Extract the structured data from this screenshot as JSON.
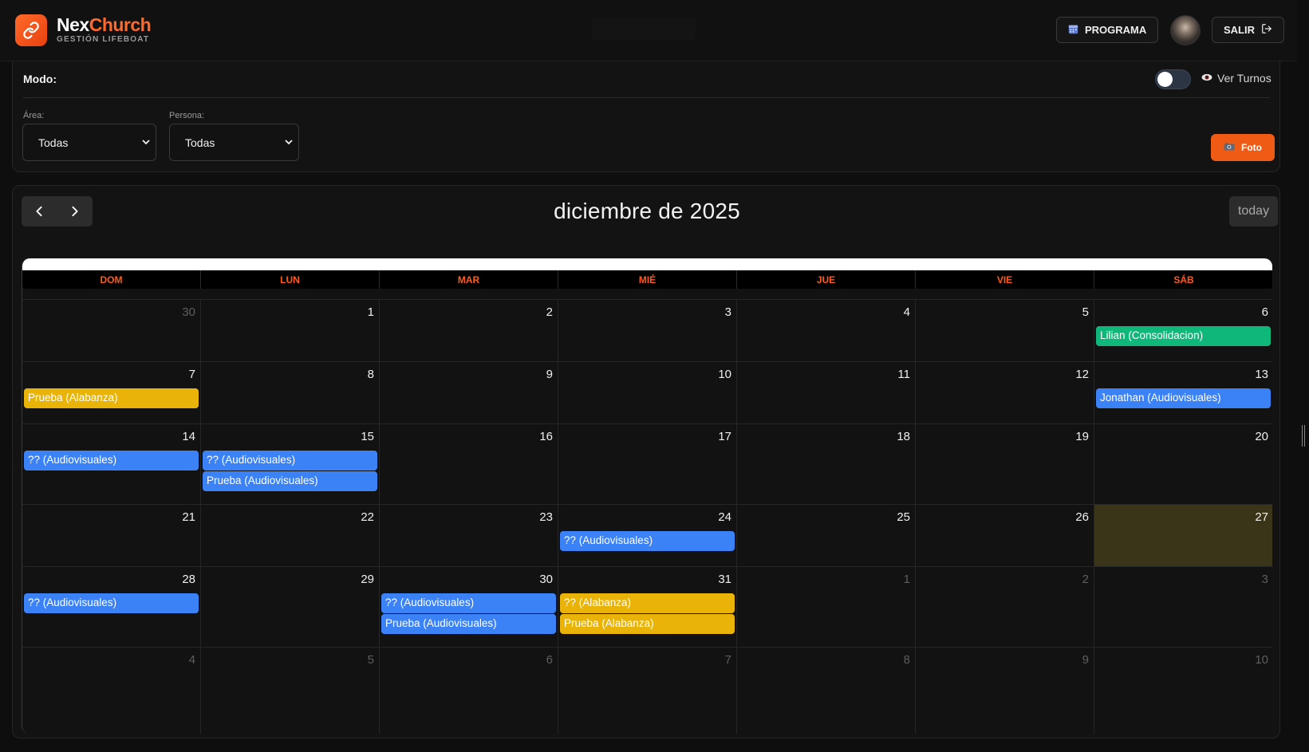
{
  "header": {
    "brand_first": "Nex",
    "brand_second": "Church",
    "subtitle": "GESTIÓN LIFEBOAT",
    "programa_label": "PROGRAMA",
    "salir_label": "SALIR"
  },
  "filters": {
    "mode_label": "Modo:",
    "ver_turnos_label": "Ver Turnos",
    "area_label": "Área:",
    "area_value": "Todas",
    "persona_label": "Persona:",
    "persona_value": "Todas",
    "foto_label": "Foto"
  },
  "calendar": {
    "title": "diciembre de 2025",
    "today_label": "today",
    "weekdays": [
      "DOM",
      "LUN",
      "MAR",
      "MIÉ",
      "JUE",
      "VIE",
      "SÁB"
    ],
    "weeks": [
      [
        {
          "num": "30",
          "other": true,
          "events": []
        },
        {
          "num": "1",
          "events": []
        },
        {
          "num": "2",
          "events": []
        },
        {
          "num": "3",
          "events": []
        },
        {
          "num": "4",
          "events": []
        },
        {
          "num": "5",
          "events": []
        },
        {
          "num": "6",
          "events": [
            {
              "title": "Lilian (Consolidacion)",
              "color": "green"
            }
          ]
        }
      ],
      [
        {
          "num": "7",
          "events": [
            {
              "title": "Prueba (Alabanza)",
              "color": "yellow"
            }
          ]
        },
        {
          "num": "8",
          "events": []
        },
        {
          "num": "9",
          "events": []
        },
        {
          "num": "10",
          "events": []
        },
        {
          "num": "11",
          "events": []
        },
        {
          "num": "12",
          "events": []
        },
        {
          "num": "13",
          "events": [
            {
              "title": "Jonathan (Audiovisuales)",
              "color": "blue"
            }
          ]
        }
      ],
      [
        {
          "num": "14",
          "events": [
            {
              "title": "?? (Audiovisuales)",
              "color": "blue"
            }
          ]
        },
        {
          "num": "15",
          "events": [
            {
              "title": "?? (Audiovisuales)",
              "color": "blue"
            },
            {
              "title": "Prueba (Audiovisuales)",
              "color": "blue"
            }
          ]
        },
        {
          "num": "16",
          "events": []
        },
        {
          "num": "17",
          "events": []
        },
        {
          "num": "18",
          "events": []
        },
        {
          "num": "19",
          "events": []
        },
        {
          "num": "20",
          "events": []
        }
      ],
      [
        {
          "num": "21",
          "events": []
        },
        {
          "num": "22",
          "events": []
        },
        {
          "num": "23",
          "events": []
        },
        {
          "num": "24",
          "events": [
            {
              "title": "?? (Audiovisuales)",
              "color": "blue"
            }
          ]
        },
        {
          "num": "25",
          "events": []
        },
        {
          "num": "26",
          "events": []
        },
        {
          "num": "27",
          "today": true,
          "events": []
        }
      ],
      [
        {
          "num": "28",
          "events": [
            {
              "title": "?? (Audiovisuales)",
              "color": "blue"
            }
          ]
        },
        {
          "num": "29",
          "events": []
        },
        {
          "num": "30",
          "events": [
            {
              "title": "?? (Audiovisuales)",
              "color": "blue"
            },
            {
              "title": "Prueba (Audiovisuales)",
              "color": "blue"
            }
          ]
        },
        {
          "num": "31",
          "events": [
            {
              "title": "?? (Alabanza)",
              "color": "yellow"
            },
            {
              "title": "Prueba (Alabanza)",
              "color": "yellow"
            }
          ]
        },
        {
          "num": "1",
          "other": true,
          "events": []
        },
        {
          "num": "2",
          "other": true,
          "events": []
        },
        {
          "num": "3",
          "other": true,
          "events": []
        }
      ],
      [
        {
          "num": "4",
          "other": true,
          "events": []
        },
        {
          "num": "5",
          "other": true,
          "events": []
        },
        {
          "num": "6",
          "other": true,
          "events": []
        },
        {
          "num": "7",
          "other": true,
          "events": []
        },
        {
          "num": "8",
          "other": true,
          "events": []
        },
        {
          "num": "9",
          "other": true,
          "events": []
        },
        {
          "num": "10",
          "other": true,
          "events": []
        }
      ]
    ]
  },
  "colors": {
    "accent": "#ef5a14",
    "event_blue": "#3b82f6",
    "event_green": "#10b77a",
    "event_yellow": "#e9b308",
    "today_bg": "#3a3418"
  }
}
